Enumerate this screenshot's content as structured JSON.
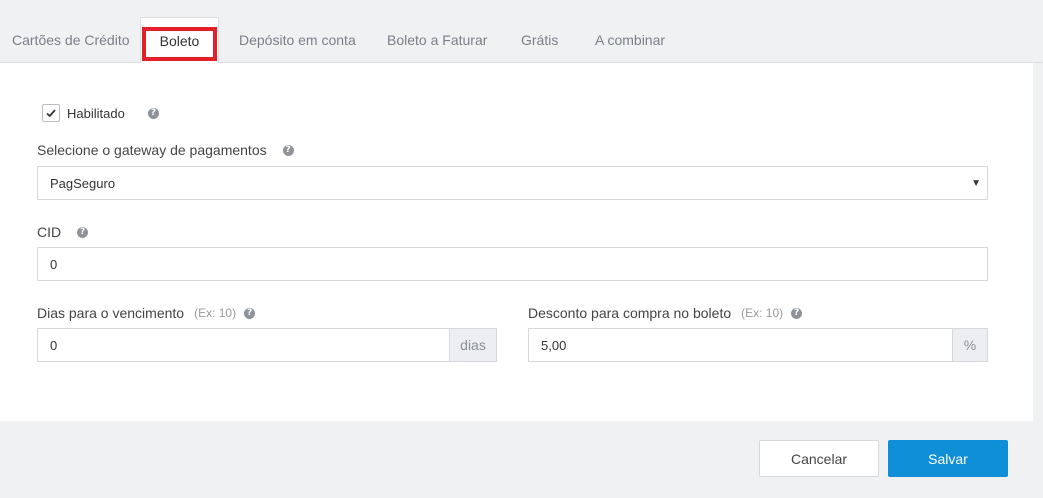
{
  "tabs": [
    {
      "label": "Cartões de Crédito",
      "active": false
    },
    {
      "label": "Boleto",
      "active": true
    },
    {
      "label": "Depósito em conta",
      "active": false
    },
    {
      "label": "Boleto a Faturar",
      "active": false
    },
    {
      "label": "Grátis",
      "active": false
    },
    {
      "label": "A combinar",
      "active": false
    }
  ],
  "form": {
    "enabled": {
      "label": "Habilitado",
      "checked": true,
      "help": "?"
    },
    "gateway": {
      "label": "Selecione o gateway de pagamentos",
      "value": "PagSeguro",
      "help": "?"
    },
    "cid": {
      "label": "CID",
      "value": "0",
      "help": "?"
    },
    "due_days": {
      "label": "Dias para o vencimento",
      "example": "(Ex: 10)",
      "value": "0",
      "suffix": "dias",
      "help": "?"
    },
    "discount": {
      "label": "Desconto para compra no boleto",
      "example": "(Ex: 10)",
      "value": "5,00",
      "suffix": "%",
      "help": "?"
    }
  },
  "actions": {
    "cancel": "Cancelar",
    "save": "Salvar"
  },
  "colors": {
    "primary": "#0e8fd8",
    "highlight": "#e3202a"
  }
}
